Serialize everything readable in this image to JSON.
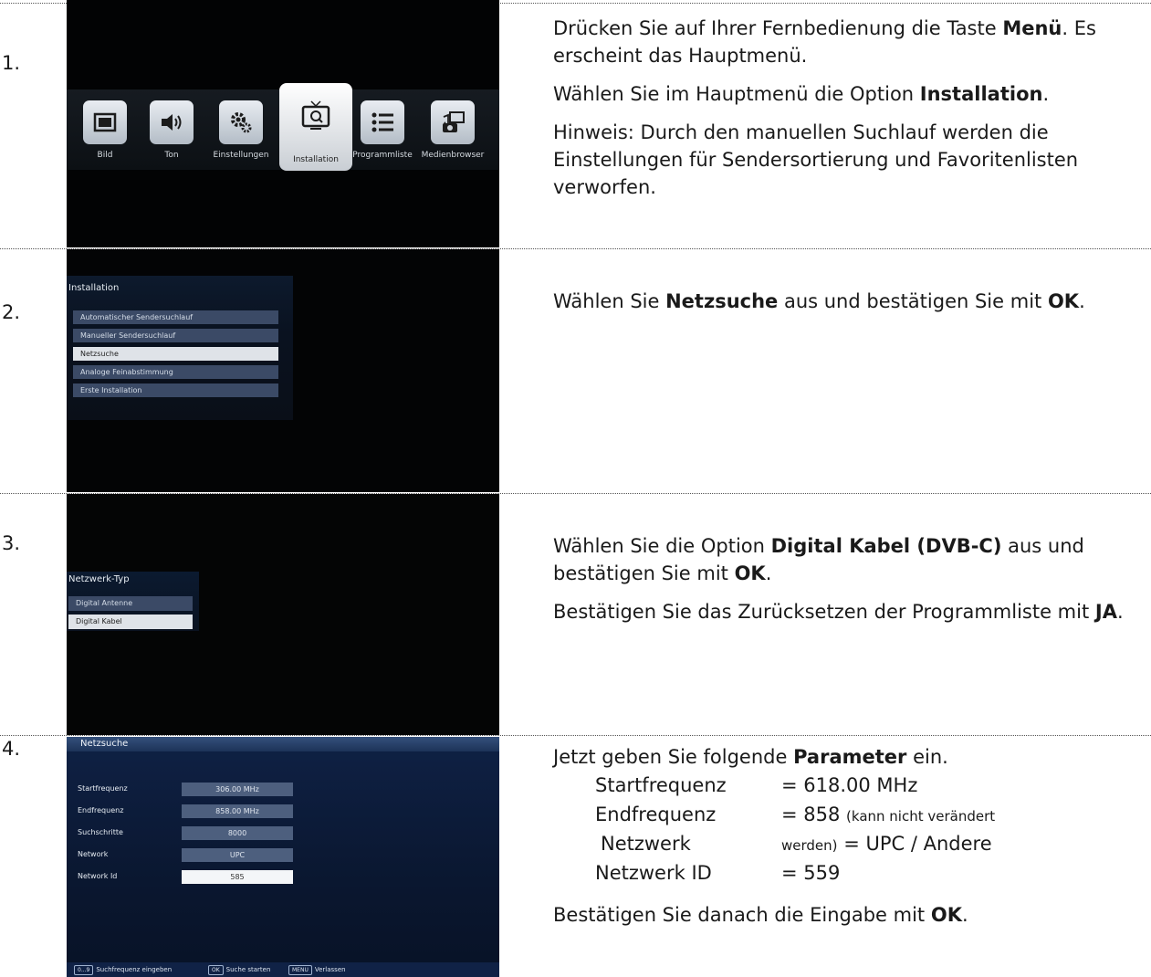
{
  "steps": [
    {
      "number": "1."
    },
    {
      "number": "2."
    },
    {
      "number": "3."
    },
    {
      "number": "4."
    }
  ],
  "screen1": {
    "menu_items": [
      "Bild",
      "Ton",
      "Einstellungen",
      "Installation",
      "Programmliste",
      "Medienbrowser"
    ],
    "selected": "Installation",
    "icons": [
      "picture-icon",
      "speaker-icon",
      "gears-icon",
      "tv-search-icon",
      "list-icon",
      "media-browser-icon"
    ]
  },
  "screen2": {
    "title": "Installation",
    "items": [
      "Automatischer Sendersuchlauf",
      "Manueller Sendersuchlauf",
      "Netzsuche",
      "Analoge Feinabstimmung",
      "Erste Installation"
    ],
    "selected": "Netzsuche"
  },
  "screen3": {
    "title": "Netzwerk-Typ",
    "items": [
      "Digital Antenne",
      "Digital Kabel"
    ],
    "selected": "Digital Kabel"
  },
  "screen4": {
    "title": "Netzsuche",
    "fields": [
      {
        "label": "Startfrequenz",
        "value": "306.00 MHz"
      },
      {
        "label": "Endfrequenz",
        "value": "858.00 MHz"
      },
      {
        "label": "Suchschritte",
        "value": "8000"
      },
      {
        "label": "Network",
        "value": "UPC"
      },
      {
        "label": "Network Id",
        "value": "585"
      }
    ],
    "footer": [
      {
        "key": "0...9",
        "label": "Suchfrequenz eingeben"
      },
      {
        "key": "OK",
        "label": "Suche starten"
      },
      {
        "key": "MENU",
        "label": "Verlassen"
      }
    ]
  },
  "desc1": {
    "p1_a": "Drücken Sie auf Ihrer Fernbedienung die Taste ",
    "p1_b": "Menü",
    "p1_c": ". Es erscheint das Hauptmenü.",
    "p2_a": "Wählen Sie im Hauptmenü die Option ",
    "p2_b": "Installation",
    "p2_c": ".",
    "p3": "Hinweis: Durch den manuellen Suchlauf werden die Einstellungen für Sendersortierung und Favoritenlisten verworfen."
  },
  "desc2": {
    "a": "Wählen Sie ",
    "b": "Netzsuche",
    "c": " aus und bestätigen Sie mit ",
    "d": "OK",
    "e": "."
  },
  "desc3": {
    "p1_a": "Wählen Sie die Option ",
    "p1_b": "Digital Kabel (DVB-C)",
    "p1_c": " aus und bestätigen Sie mit ",
    "p1_d": "OK",
    "p1_e": ".",
    "p2_a": "Bestätigen Sie das Zurücksetzen der Programmliste mit ",
    "p2_b": "JA",
    "p2_c": "."
  },
  "desc4": {
    "intro_a": "Jetzt geben Sie folgende ",
    "intro_b": "Parameter",
    "intro_c": " ein.",
    "params": [
      {
        "label": "Startfrequenz",
        "value": "= 618.00 MHz"
      },
      {
        "label": "Endfrequenz",
        "value": "= 858",
        "note": "(kann nicht verändert"
      },
      {
        "label": "Netzwerk",
        "note": "werden)",
        "value": "= UPC / Andere"
      },
      {
        "label": "Netzwerk ID",
        "value": "= 559"
      }
    ],
    "outro_a": "Bestätigen Sie danach die Eingabe mit ",
    "outro_b": "OK",
    "outro_c": "."
  }
}
